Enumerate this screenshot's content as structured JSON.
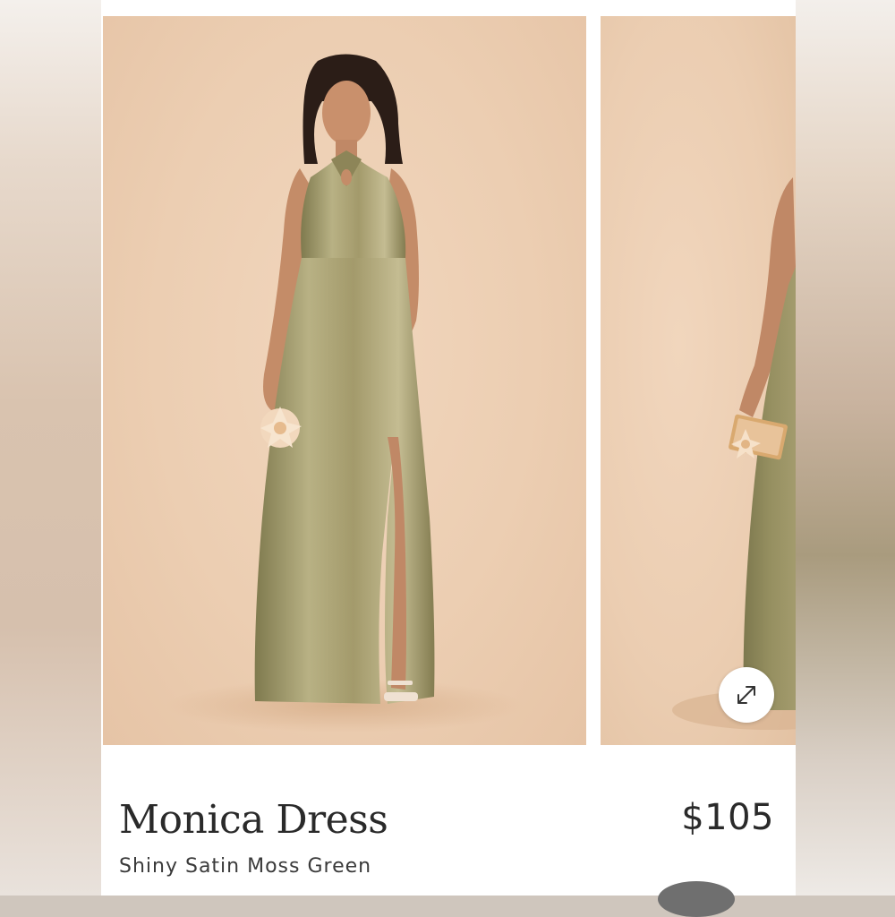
{
  "product": {
    "name": "Monica Dress",
    "variant": "Shiny Satin Moss Green",
    "price": "$105"
  },
  "gallery": {
    "images": [
      {
        "subject": "model-front-view",
        "dress_color": "#a39a6b"
      },
      {
        "subject": "model-side-view",
        "dress_color": "#8f8a5c"
      }
    ],
    "expand_icon": "expand-arrows-icon"
  },
  "colors": {
    "backdrop": "#ecceb2",
    "dress": "#a39a6b",
    "text": "#2a2a2a"
  }
}
